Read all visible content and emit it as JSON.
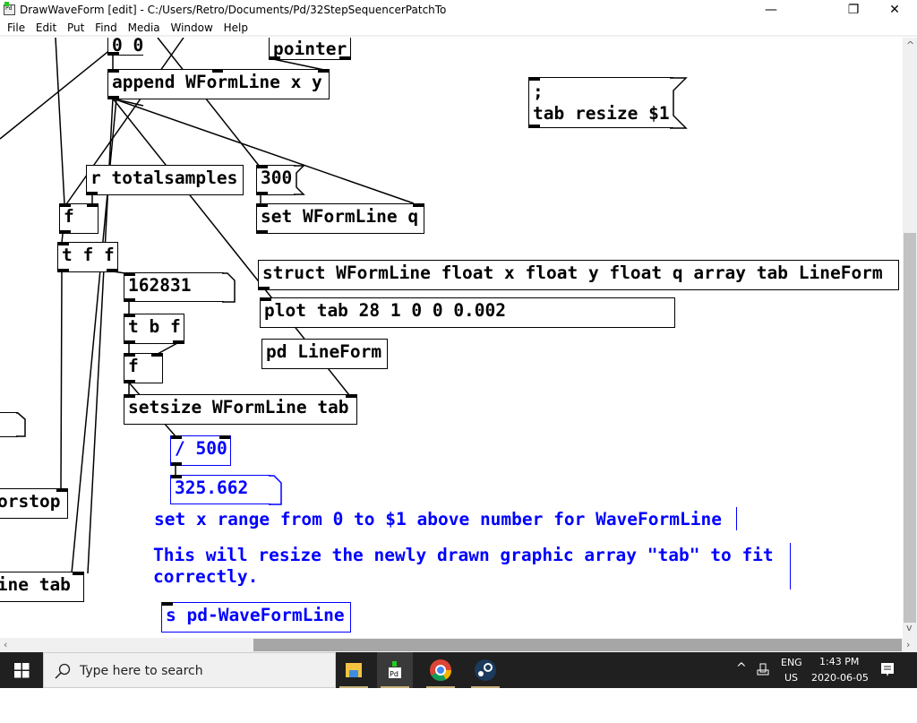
{
  "window": {
    "title": "DrawWaveForm  [edit] - C:/Users/Retro/Documents/Pd/32StepSequencerPatchTo",
    "minimize": "—",
    "maximize": "❐",
    "close": "✕"
  },
  "menu": [
    "File",
    "Edit",
    "Put",
    "Find",
    "Media",
    "Window",
    "Help"
  ],
  "patch": {
    "msg_00": "0 0",
    "pointer": "pointer",
    "append": "append WFormLine x y",
    "msg_resize_1": ";",
    "msg_resize_2": "tab resize $1",
    "r_total": "r totalsamples",
    "msg_300": "300",
    "set_q": "set WFormLine q",
    "f1": "f",
    "tff": "t f f",
    "num_162831": "162831",
    "struct": "struct WFormLine float x float y float q array tab LineForm",
    "plot": "plot tab 28 1 0 0 0.002",
    "pd_lineform": "pd LineForm",
    "tbf": "t b f",
    "f2": "f",
    "setsize": "setsize WFormLine tab",
    "div500": "/ 500",
    "num_325": "325.662",
    "comment1": "set x range from 0 to $1 above number for WaveFormLine",
    "comment2": "This will resize the newly drawn graphic array \"tab\" to fit\ncorrectly.",
    "send": "s pd-WaveFormLine",
    "left_orstop": "orstop",
    "left_linetab": "Line tab"
  },
  "taskbar": {
    "search_placeholder": "Type here to search",
    "lang1": "ENG",
    "lang2": "US",
    "time": "1:43 PM",
    "date": "2020-06-05",
    "apps": [
      "file-explorer",
      "pure-data",
      "chrome",
      "steam"
    ]
  },
  "colors": {
    "edit_blue": "#0000ff",
    "taskbar": "#202020"
  }
}
